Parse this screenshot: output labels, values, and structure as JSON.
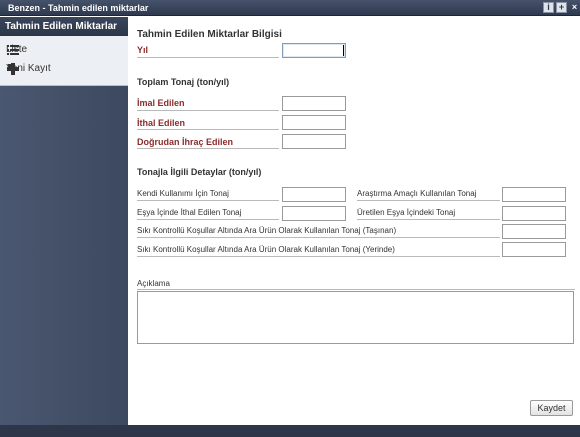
{
  "window": {
    "title": "Benzen - Tahmin edilen miktarlar",
    "buttons": [
      {
        "name": "info-button",
        "glyph": "i"
      },
      {
        "name": "maximize-button",
        "glyph": "+"
      },
      {
        "name": "close-button",
        "glyph": "×"
      }
    ]
  },
  "sidebar": {
    "header": "Tahmin Edilen Miktarlar",
    "items": [
      {
        "label": "Liste",
        "icon": "list-icon"
      },
      {
        "label": "Yeni Kayıt",
        "icon": "plus-icon"
      }
    ]
  },
  "form": {
    "title": "Tahmin Edilen Miktarlar Bilgisi",
    "year_label": "Yıl",
    "year_value": "",
    "total_title": "Toplam Tonaj (ton/yıl)",
    "imal_label": "İmal Edilen",
    "ithal_label": "İthal Edilen",
    "ihrac_label": "Doğrudan İhraç Edilen",
    "details_title": "Tonajla İlgili Detaylar (ton/yıl)",
    "kendi_label": "Kendi Kullanımı İçin Tonaj",
    "arastirma_label": "Araştırma Amaçlı Kullanılan Tonaj",
    "esya_ithal_label": "Eşya İçinde İthal Edilen Tonaj",
    "esya_uretilen_label": "Üretilen Eşya İçindeki Tonaj",
    "tasinan_label": "Sıkı Kontrollü Koşullar Altında Ara Ürün Olarak Kullanılan Tonaj (Taşınan)",
    "yerinde_label": "Sıkı Kontrollü Koşullar Altında Ara Ürün Olarak Kullanılan Tonaj (Yerinde)",
    "aciklama_label": "Açıklama",
    "aciklama_value": "",
    "save_label": "Kaydet"
  },
  "colors": {
    "titlebar": "#3a465c",
    "sidebar": "#4a5770",
    "label_red": "#8b2c2c"
  }
}
